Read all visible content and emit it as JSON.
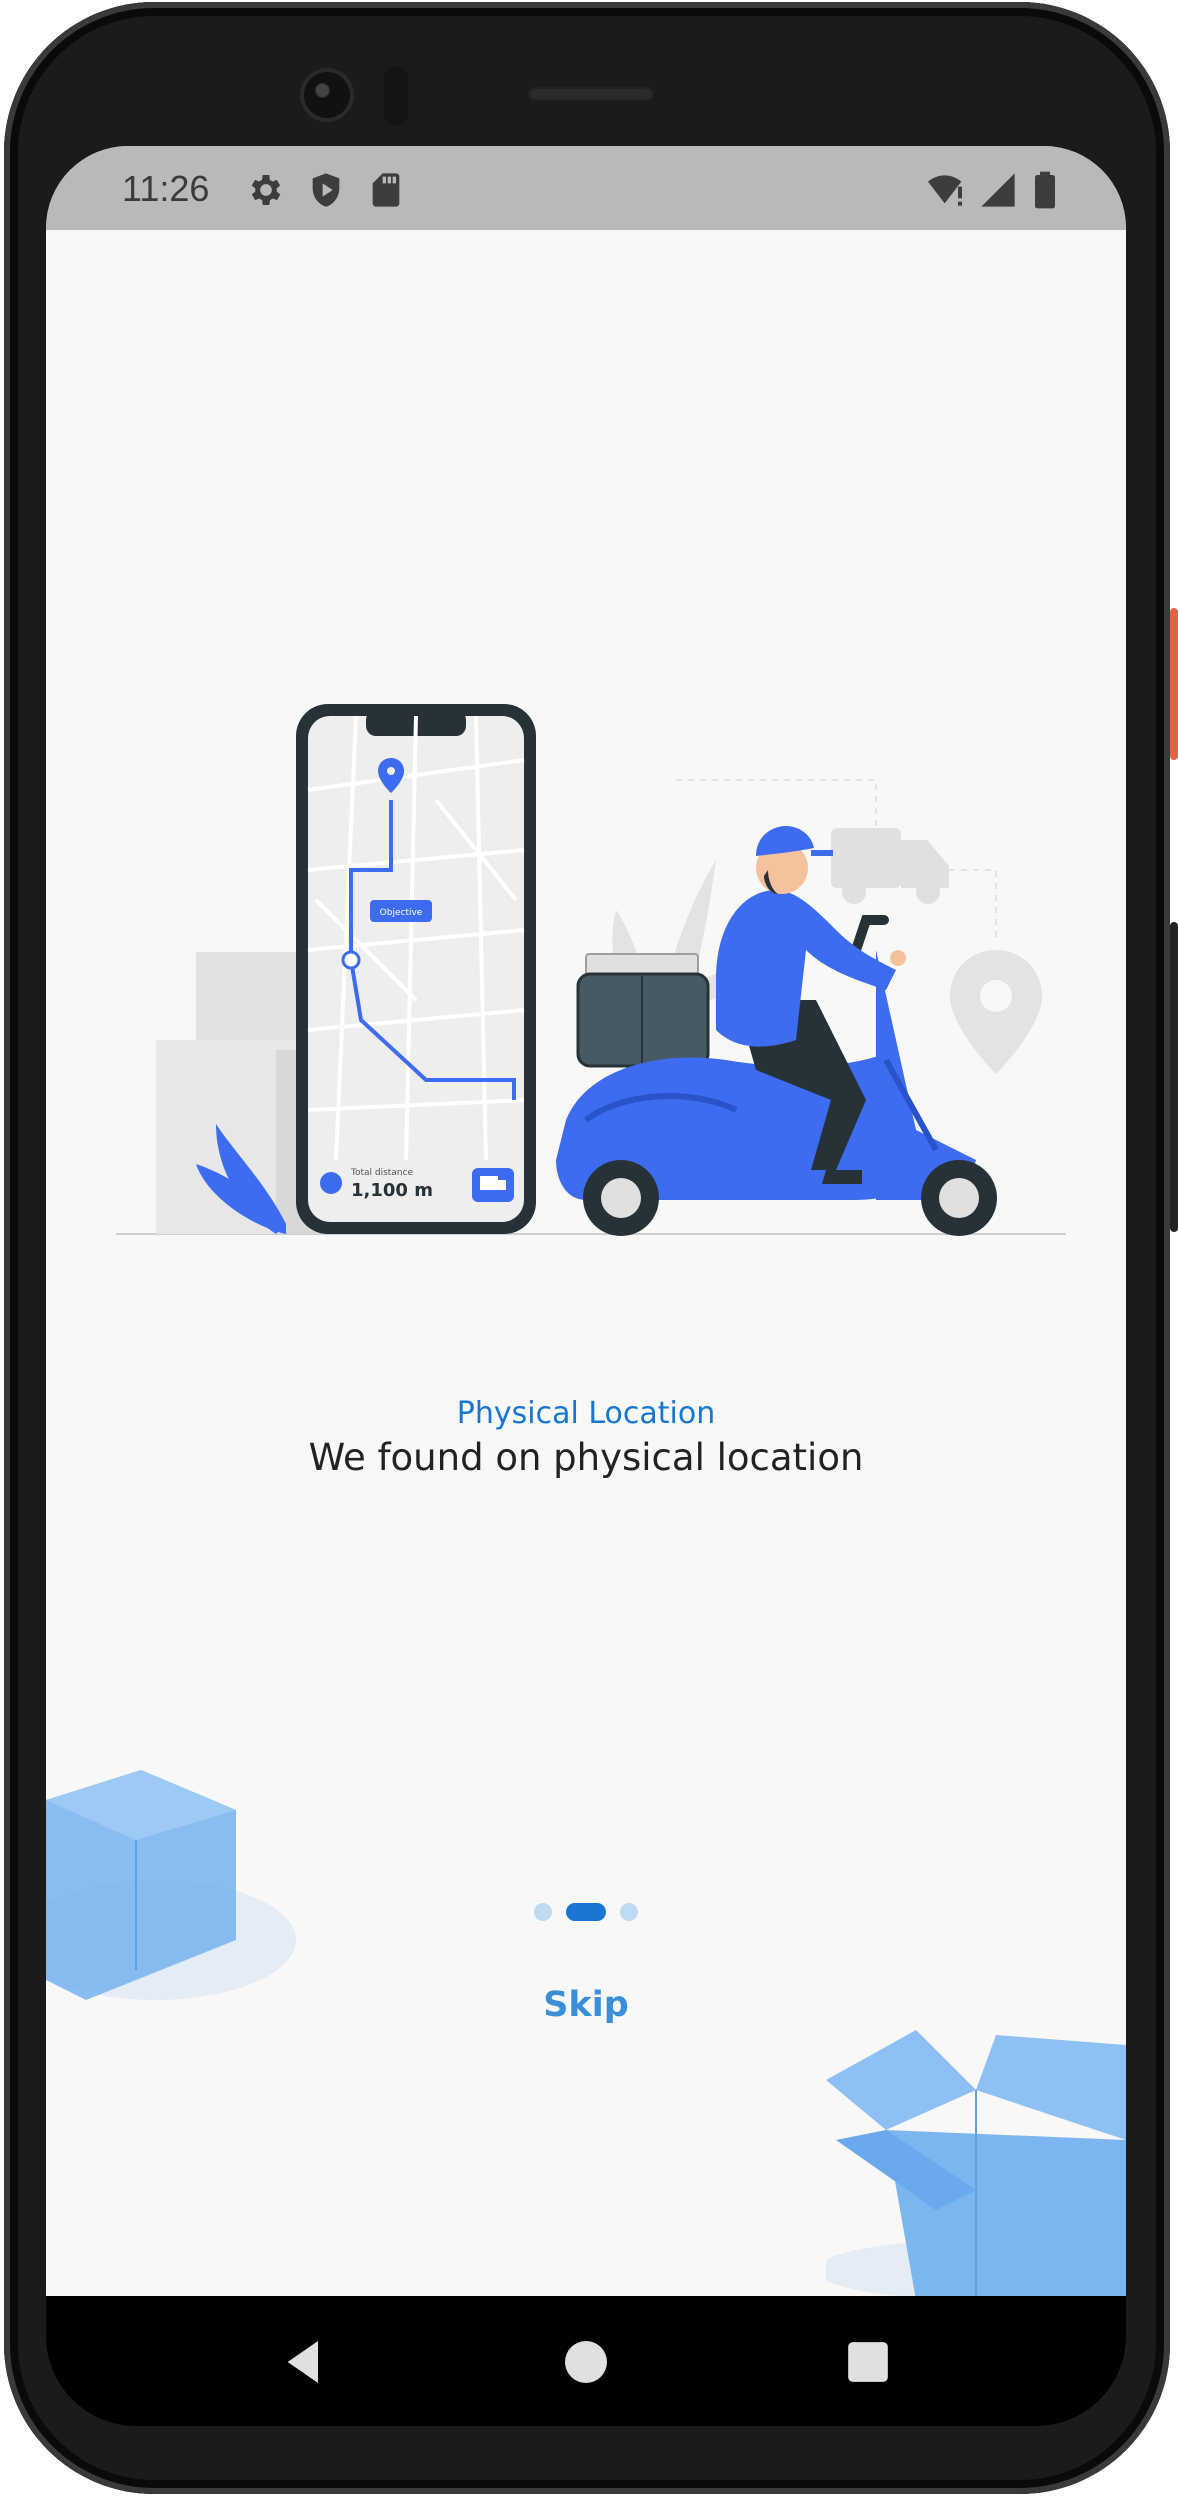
{
  "status_bar": {
    "time": "11:26",
    "icons": [
      "settings-gear-icon",
      "shield-icon",
      "sd-card-icon",
      "wifi-alert-icon",
      "cell-signal-icon",
      "battery-icon"
    ]
  },
  "onboarding": {
    "title": "Physical Location",
    "subtitle": "We found on physical location",
    "skip_label": "Skip",
    "page_indicator": {
      "count": 3,
      "current": 2
    },
    "illustration": {
      "map_label": "Objective",
      "distance_label": "Total distance",
      "distance_value": "1,100 m"
    }
  },
  "navigation_bar": [
    "back-icon",
    "home-icon",
    "recents-icon"
  ],
  "colors": {
    "accent": "#1976d2",
    "illustration_blue": "#3d6cf0",
    "box_blue": "#7cb6f0",
    "background": "#f8f8f8",
    "status_bar": "#b9b9b9"
  }
}
